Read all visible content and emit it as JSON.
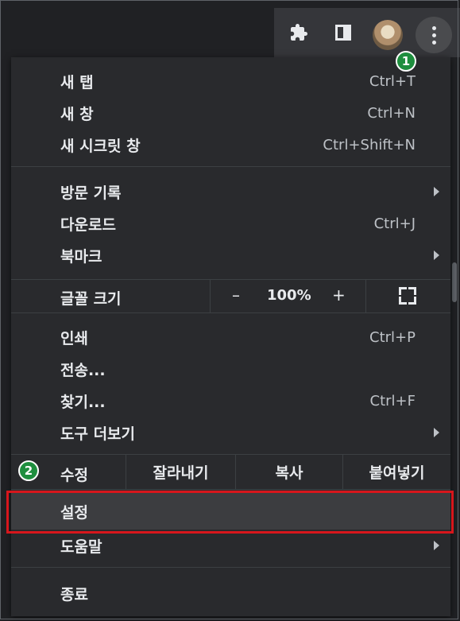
{
  "toolbar": {
    "icons": [
      "extensions-icon",
      "side-panel-icon",
      "profile-avatar",
      "more-menu-icon"
    ]
  },
  "badges": {
    "step1": "1",
    "step2": "2"
  },
  "menu": {
    "new_tab": {
      "label": "새 탭",
      "shortcut": "Ctrl+T"
    },
    "new_window": {
      "label": "새 창",
      "shortcut": "Ctrl+N"
    },
    "incognito": {
      "label": "새 시크릿 창",
      "shortcut": "Ctrl+Shift+N"
    },
    "history": {
      "label": "방문 기록"
    },
    "downloads": {
      "label": "다운로드",
      "shortcut": "Ctrl+J"
    },
    "bookmarks": {
      "label": "북마크"
    },
    "zoom": {
      "label": "글꼴 크기",
      "minus": "–",
      "value": "100%",
      "plus": "+"
    },
    "print": {
      "label": "인쇄",
      "shortcut": "Ctrl+P"
    },
    "cast": {
      "label": "전송..."
    },
    "find": {
      "label": "찾기...",
      "shortcut": "Ctrl+F"
    },
    "more_tools": {
      "label": "도구 더보기"
    },
    "edit": {
      "label": "수정",
      "cut": "잘라내기",
      "copy": "복사",
      "paste": "붙여넣기"
    },
    "settings": {
      "label": "설정"
    },
    "help": {
      "label": "도움말"
    },
    "exit": {
      "label": "종료"
    }
  },
  "colors": {
    "menu_bg": "#292a2d",
    "highlight_border": "#d7161c",
    "badge_green": "#1e8e3e"
  }
}
